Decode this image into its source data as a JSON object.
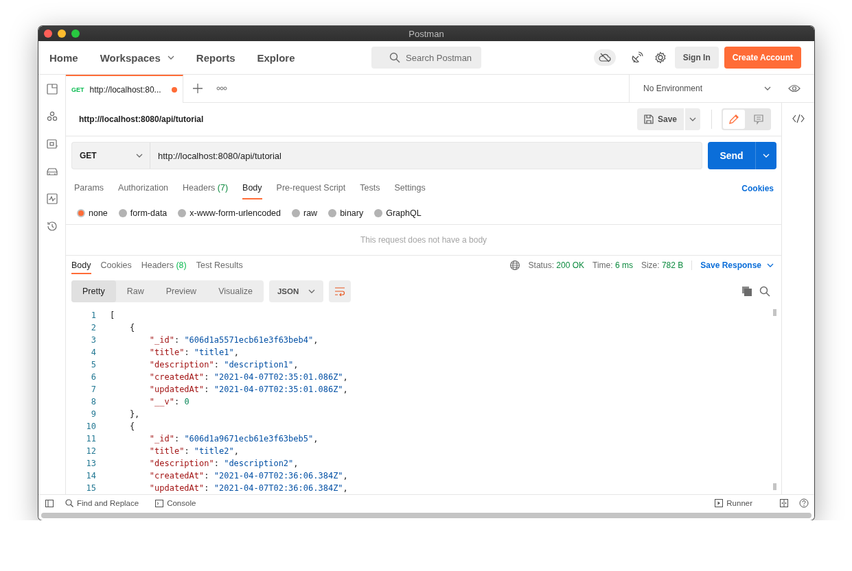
{
  "window": {
    "title": "Postman"
  },
  "topbar": {
    "nav": [
      {
        "label": "Home",
        "dropdown": false
      },
      {
        "label": "Workspaces",
        "dropdown": true
      },
      {
        "label": "Reports",
        "dropdown": false
      },
      {
        "label": "Explore",
        "dropdown": false
      }
    ],
    "search": {
      "placeholder": "Search Postman"
    },
    "sign_in": "Sign In",
    "create_account": "Create Account"
  },
  "tabs": [
    {
      "method": "GET",
      "label": "http://localhost:80...",
      "unsaved": true,
      "selected": true
    }
  ],
  "environment": "No Environment",
  "request": {
    "title": "http://localhost:8080/api/tutorial",
    "save": "Save",
    "side_panel": [
      {
        "kind": "edit",
        "selected": true
      },
      {
        "kind": "comments",
        "selected": false
      }
    ],
    "method": "GET",
    "url": "http://localhost:8080/api/tutorial",
    "send": "Send",
    "tabs": [
      {
        "label": "Params",
        "selected": false
      },
      {
        "label": "Authorization",
        "selected": false
      },
      {
        "label": "Headers",
        "count": "(7)",
        "selected": false
      },
      {
        "label": "Body",
        "selected": true
      },
      {
        "label": "Pre-request Script",
        "selected": false
      },
      {
        "label": "Tests",
        "selected": false
      },
      {
        "label": "Settings",
        "selected": false
      }
    ],
    "cookies": "Cookies",
    "body_types": [
      {
        "label": "none",
        "selected": true
      },
      {
        "label": "form-data",
        "selected": false
      },
      {
        "label": "x-www-form-urlencoded",
        "selected": false
      },
      {
        "label": "raw",
        "selected": false
      },
      {
        "label": "binary",
        "selected": false
      },
      {
        "label": "GraphQL",
        "selected": false
      }
    ],
    "empty_message": "This request does not have a body"
  },
  "response": {
    "tabs": [
      {
        "label": "Body",
        "selected": true
      },
      {
        "label": "Cookies",
        "selected": false
      },
      {
        "label": "Headers",
        "count": "(8)",
        "selected": false
      },
      {
        "label": "Test Results",
        "selected": false
      }
    ],
    "stats": [
      {
        "label": "Status:",
        "value": "200 OK"
      },
      {
        "label": "Time:",
        "value": "6 ms"
      },
      {
        "label": "Size:",
        "value": "782 B"
      }
    ],
    "save_response": "Save Response",
    "view_modes": [
      {
        "label": "Pretty",
        "selected": true
      },
      {
        "label": "Raw",
        "selected": false
      },
      {
        "label": "Preview",
        "selected": false
      },
      {
        "label": "Visualize",
        "selected": false
      }
    ],
    "format": "JSON",
    "lines": [
      {
        "number": "1",
        "text": "["
      },
      {
        "number": "2",
        "text": "    {"
      },
      {
        "number": "3",
        "text": "        \"_id\": \"606d1a5571ecb61e3f63beb4\","
      },
      {
        "number": "4",
        "text": "        \"title\": \"title1\","
      },
      {
        "number": "5",
        "text": "        \"description\": \"description1\","
      },
      {
        "number": "6",
        "text": "        \"createdAt\": \"2021-04-07T02:35:01.086Z\","
      },
      {
        "number": "7",
        "text": "        \"updatedAt\": \"2021-04-07T02:35:01.086Z\","
      },
      {
        "number": "8",
        "text": "        \"__v\": 0"
      },
      {
        "number": "9",
        "text": "    },"
      },
      {
        "number": "10",
        "text": "    {"
      },
      {
        "number": "11",
        "text": "        \"_id\": \"606d1a9671ecb61e3f63beb5\","
      },
      {
        "number": "12",
        "text": "        \"title\": \"title2\","
      },
      {
        "number": "13",
        "text": "        \"description\": \"description2\","
      },
      {
        "number": "14",
        "text": "        \"createdAt\": \"2021-04-07T02:36:06.384Z\","
      },
      {
        "number": "15",
        "text": "        \"updatedAt\": \"2021-04-07T02:36:06.384Z\","
      }
    ]
  },
  "footer": {
    "find_replace": "Find and Replace",
    "console": "Console",
    "runner": "Runner"
  }
}
